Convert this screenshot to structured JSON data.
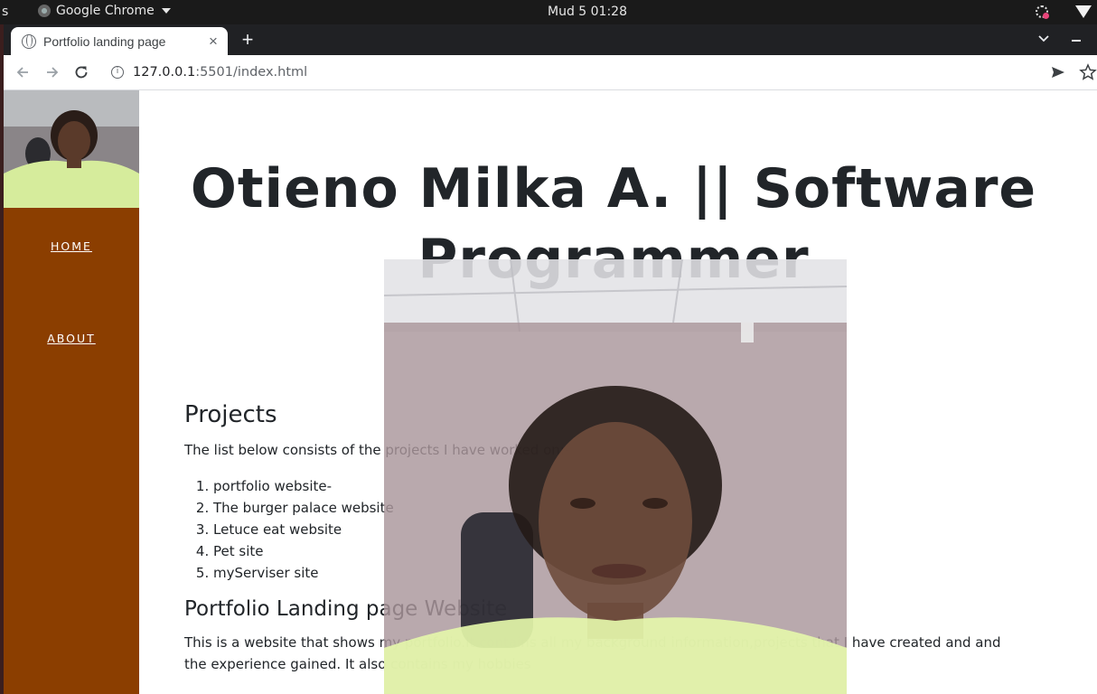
{
  "os": {
    "left_fragment": "s",
    "app_name": "Google Chrome",
    "clock": "Mud 5  01:28"
  },
  "browser": {
    "tab_title": "Portfolio landing page",
    "tab_close": "×",
    "new_tab": "+",
    "url_host": "127.0.0.1",
    "url_rest": ":5501/index.html"
  },
  "sidebar": {
    "nav": [
      {
        "label": "HOME"
      },
      {
        "label": "ABOUT"
      }
    ]
  },
  "main": {
    "heading_line1": "Otieno Milka A. || Software",
    "heading_line2": "Programmer",
    "projects_heading": "Projects",
    "projects_intro": "The list below consists of the projects I have worked on:-",
    "projects": [
      "portfolio website-",
      "The burger palace website",
      "Letuce eat website",
      "Pet site",
      "myServiser site"
    ],
    "portfolio_heading": "Portfolio Landing page Website",
    "portfolio_desc": "This is a website that shows my portfolio.It contains all my background information,projects that I have created and and the experience gained. It also contains my hobbies"
  },
  "colors": {
    "sidebar_bg": "#8b3e00",
    "heading_text": "#212529",
    "tab_strip": "#202124"
  },
  "icons": [
    "back-arrow-icon",
    "forward-arrow-icon",
    "reload-icon",
    "info-icon",
    "send-icon",
    "star-icon",
    "globe-icon",
    "chevron-down-icon",
    "wifi-icon"
  ]
}
